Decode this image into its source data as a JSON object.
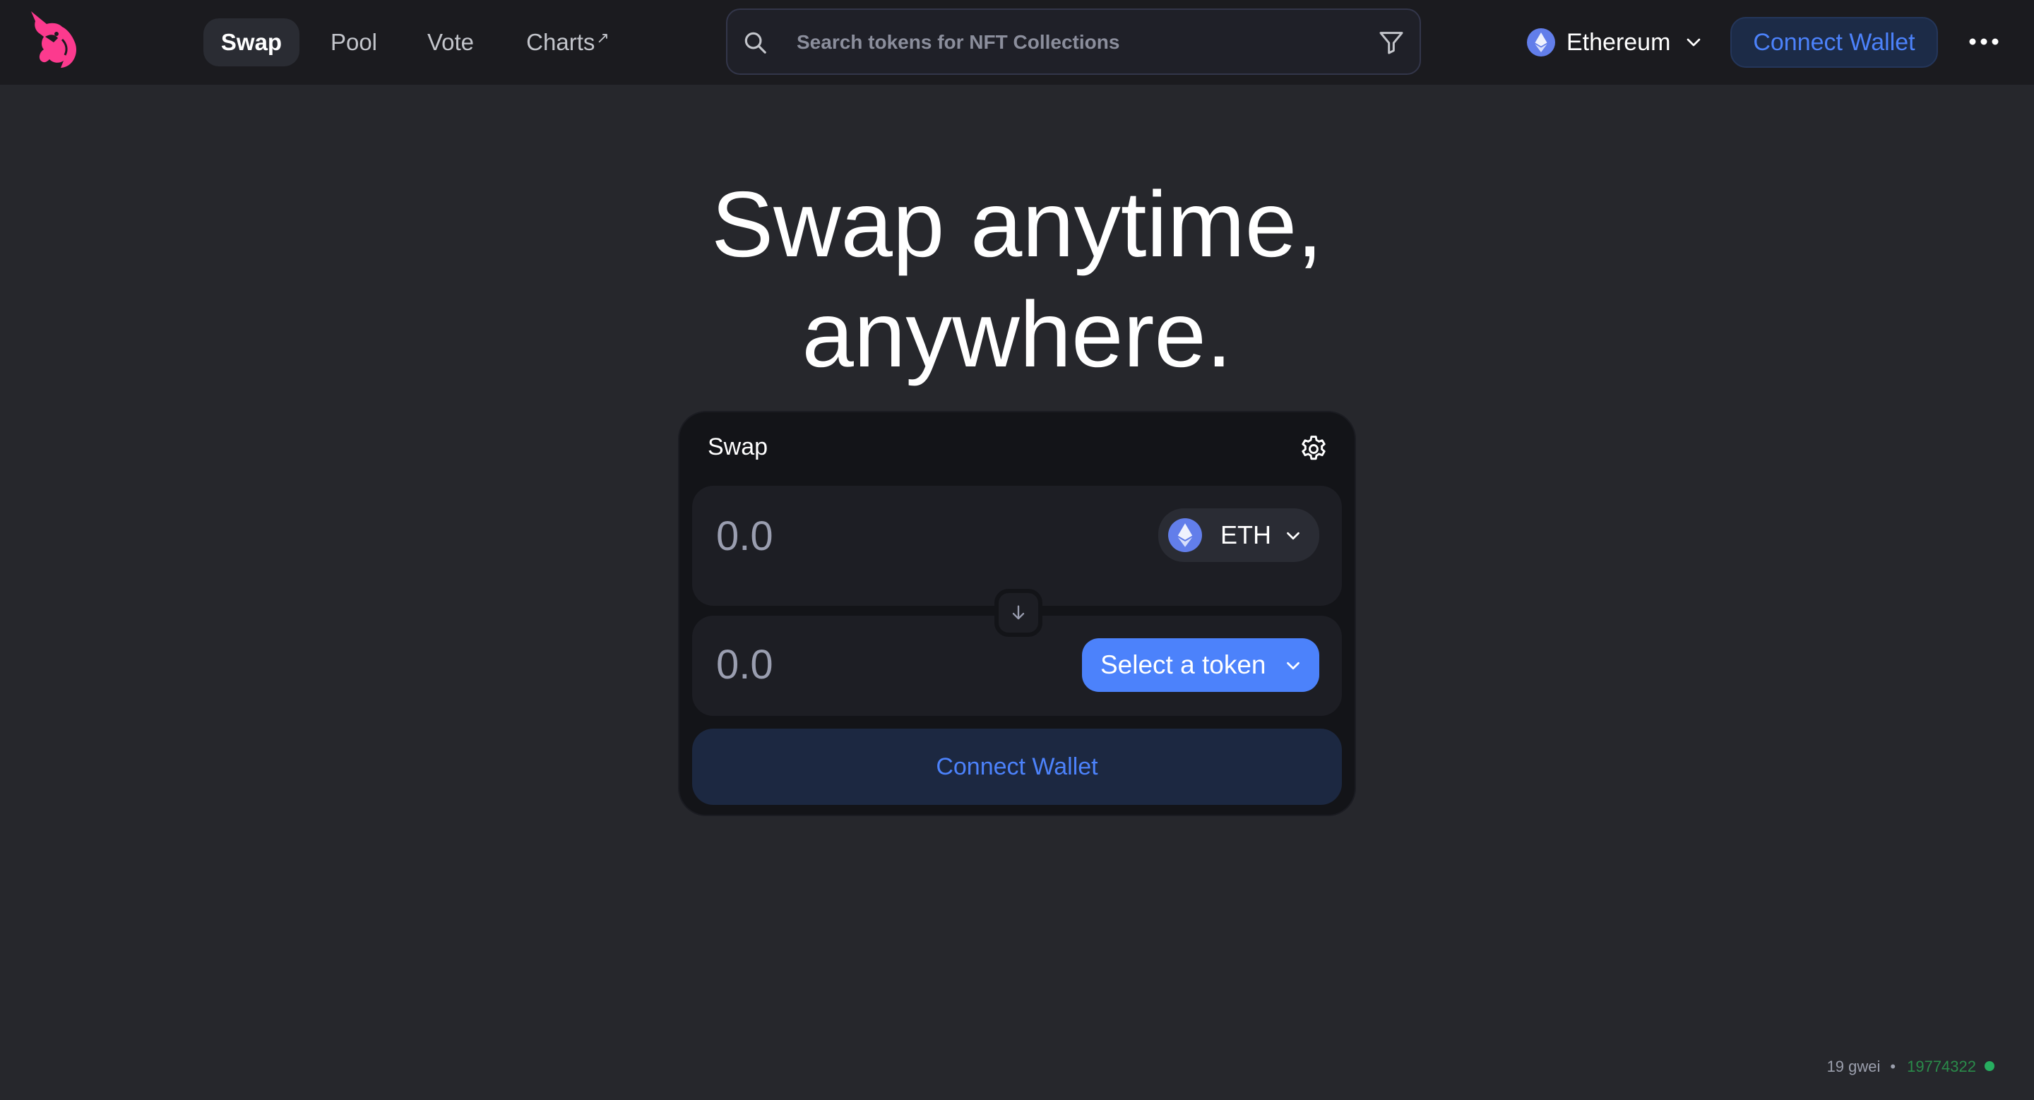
{
  "nav": {
    "links": [
      {
        "label": "Swap"
      },
      {
        "label": "Pool"
      },
      {
        "label": "Vote"
      },
      {
        "label": "Charts",
        "suffix": "↗"
      }
    ],
    "search_placeholder": "Search tokens for NFT Collections",
    "network": "Ethereum",
    "connect_label": "Connect Wallet"
  },
  "hero": {
    "line1": "Swap anytime,",
    "line2": "anywhere."
  },
  "swap": {
    "title": "Swap",
    "input_amount_placeholder": "0.0",
    "input_token": "ETH",
    "output_amount_placeholder": "0.0",
    "output_token_label": "Select a token",
    "connect_label": "Connect Wallet"
  },
  "status": {
    "gas": "19 gwei",
    "separator": "•",
    "block": "19774322"
  },
  "colors": {
    "accent": "#4c82fb",
    "brand_pink": "#fc72ff",
    "status_green": "#27ae60"
  },
  "icons": [
    "uniswap-logo",
    "search-icon",
    "filter-icon",
    "ethereum-icon",
    "chevron-down-icon",
    "more-icon",
    "gear-icon",
    "arrow-down-icon"
  ]
}
